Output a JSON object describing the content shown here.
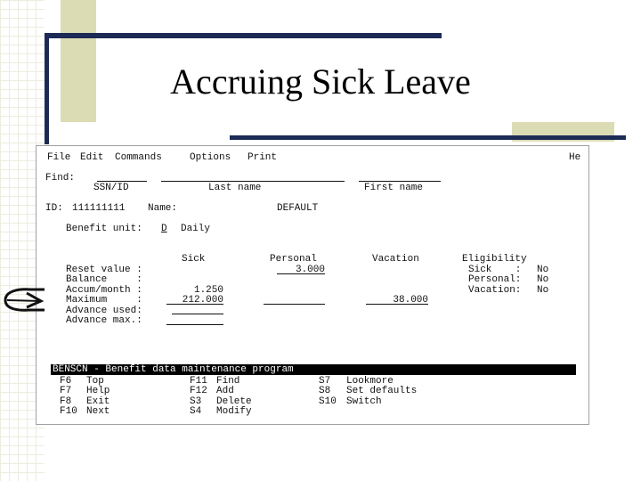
{
  "slide": {
    "title": "Accruing Sick Leave"
  },
  "menu": {
    "file": "File",
    "edit": "Edit",
    "commands": "Commands",
    "options": "Options",
    "print": "Print",
    "help": "He"
  },
  "find": {
    "label": "Find:",
    "ssn_label": "SSN/ID",
    "last_label": "Last name",
    "first_label": "First name"
  },
  "record": {
    "id_label": "ID:",
    "id_value": "111111111",
    "name_label": "Name:",
    "name_value": "DEFAULT"
  },
  "benefit_unit": {
    "label": "Benefit unit:",
    "code": "D",
    "desc": "Daily"
  },
  "columns": {
    "sick": "Sick",
    "personal": "Personal",
    "vacation": "Vacation",
    "eligibility": "Eligibility"
  },
  "rows": {
    "reset": {
      "label": "Reset value :",
      "personal": "3.000"
    },
    "balance": {
      "label": "Balance     :"
    },
    "accum": {
      "label": "Accum/month :",
      "sick": "1.250"
    },
    "maximum": {
      "label": "Maximum     :",
      "sick": "212.000",
      "vacation": "38.000"
    },
    "adv_used": {
      "label": "Advance used:"
    },
    "adv_max": {
      "label": "Advance max.:"
    }
  },
  "eligibility": [
    {
      "label": "Sick    :",
      "value": "No"
    },
    {
      "label": "Personal:",
      "value": "No"
    },
    {
      "label": "Vacation:",
      "value": "No"
    }
  ],
  "status": {
    "text": "BENSCN - Benefit data maintenance program"
  },
  "fkeys": [
    {
      "key": "F6",
      "label": "Top"
    },
    {
      "key": "F7",
      "label": "Help"
    },
    {
      "key": "F8",
      "label": "Exit"
    },
    {
      "key": "F10",
      "label": "Next"
    },
    {
      "key": "F11",
      "label": "Find"
    },
    {
      "key": "F12",
      "label": "Add"
    },
    {
      "key": "S3",
      "label": "Delete"
    },
    {
      "key": "S4",
      "label": "Modify"
    },
    {
      "key": "S7",
      "label": "Lookmore"
    },
    {
      "key": "S8",
      "label": "Set defaults"
    },
    {
      "key": "S10",
      "label": "Switch"
    }
  ]
}
